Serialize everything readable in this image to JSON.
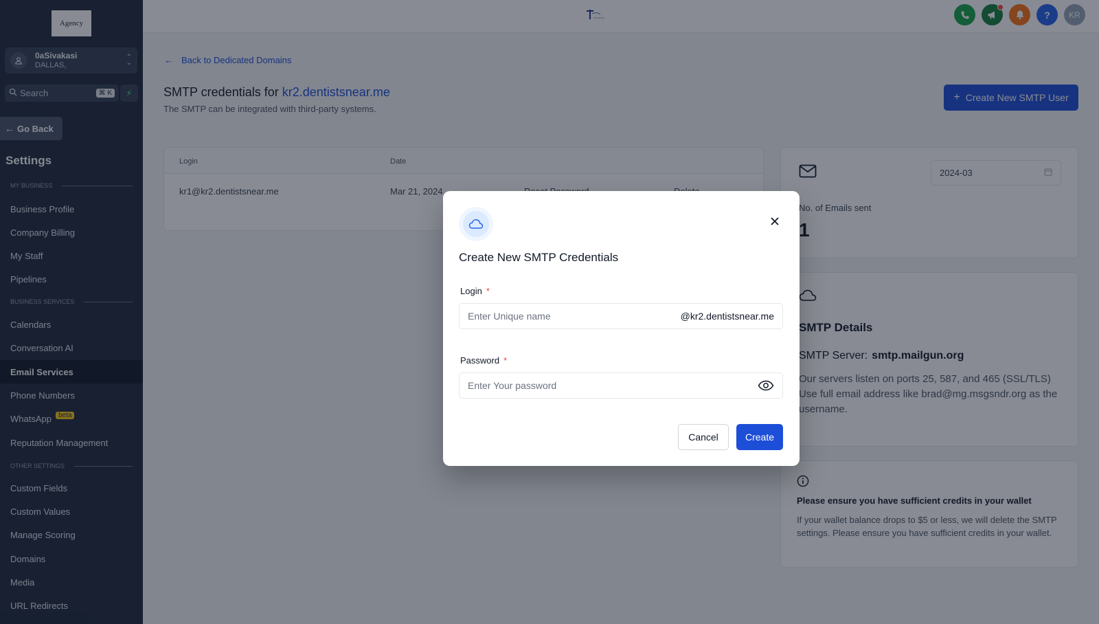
{
  "brand": {
    "logo_text": "Agency",
    "primary": "#1d4ed8",
    "sidebar_bg": "#1e293b"
  },
  "sidebar": {
    "location_name": "0aSivakasi",
    "location_city": "DALLAS,",
    "search_placeholder": "Search",
    "search_shortcut": "⌘ K",
    "go_back": "Go Back",
    "settings_title": "Settings",
    "sections": {
      "my_business": "MY BUSINESS",
      "business_services": "BUSINESS SERVICES",
      "other_settings": "OTHER SETTINGS"
    },
    "items": {
      "business_profile": "Business Profile",
      "company_billing": "Company Billing",
      "my_staff": "My Staff",
      "pipelines": "Pipelines",
      "calendars": "Calendars",
      "conversation_ai": "Conversation AI",
      "email_services": "Email Services",
      "phone_numbers": "Phone Numbers",
      "whatsapp": "WhatsApp",
      "whatsapp_badge": "beta",
      "reputation_management": "Reputation Management",
      "custom_fields": "Custom Fields",
      "custom_values": "Custom Values",
      "manage_scoring": "Manage Scoring",
      "domains": "Domains",
      "media": "Media",
      "url_redirects": "URL Redirects"
    }
  },
  "topbar": {
    "icons": [
      "phone-icon",
      "megaphone-icon",
      "bell-icon",
      "help-icon"
    ],
    "avatar_initials": "KR",
    "help_glyph": "?"
  },
  "main": {
    "back_link": "Back to Dedicated Domains",
    "title_prefix": "SMTP credentials for",
    "title_domain": "kr2.dentistsnear.me",
    "subtitle": "The SMTP can be integrated with third-party systems.",
    "create_button": "Create New SMTP User",
    "table": {
      "headers": {
        "login": "Login",
        "date": "Date"
      },
      "rows": [
        {
          "login": "kr1@kr2.dentistsnear.me",
          "date": "Mar 21, 2024",
          "reset": "Reset Password",
          "delete": "Delete"
        }
      ]
    },
    "stats": {
      "month": "2024-03",
      "emails_sent_label": "No. of Emails sent",
      "emails_sent_value": "1"
    },
    "smtp_details": {
      "title": "SMTP Details",
      "server_label": "SMTP Server:",
      "server_value": "smtp.mailgun.org",
      "ports_text": "Our servers listen on ports 25, 587, and 465 (SSL/TLS)",
      "username_text": "Use full email address like brad@mg.msgsndr.org as the username."
    },
    "credits": {
      "title": "Please ensure you have sufficient credits in your wallet",
      "text": "If your wallet balance drops to $5 or less, we will delete the SMTP settings. Please ensure you have sufficient credits in your wallet."
    }
  },
  "modal": {
    "title": "Create New SMTP Credentials",
    "login_label": "Login",
    "login_placeholder": "Enter Unique name",
    "login_suffix": "@kr2.dentistsnear.me",
    "password_label": "Password",
    "password_placeholder": "Enter Your password",
    "required_mark": "*",
    "cancel": "Cancel",
    "create": "Create"
  }
}
